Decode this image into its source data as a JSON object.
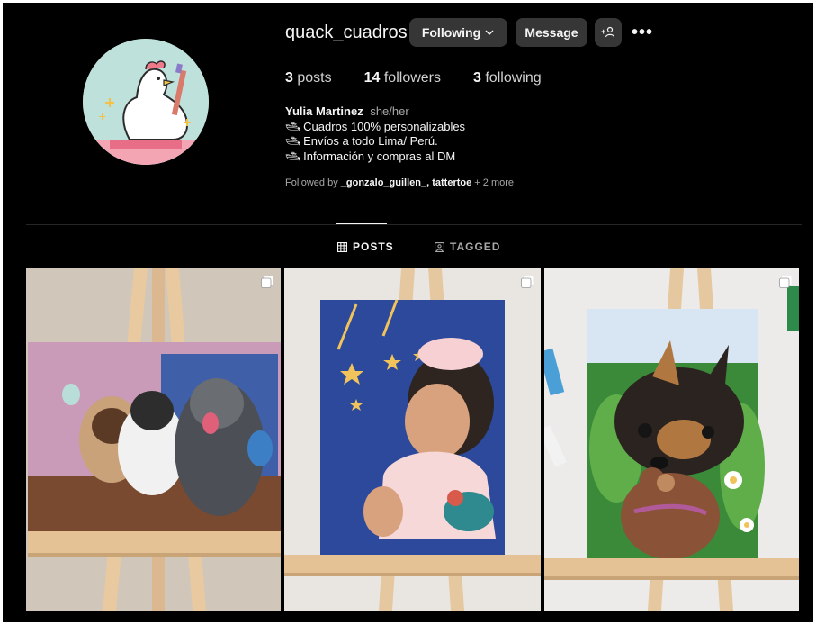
{
  "profile": {
    "username": "quack_cuadros",
    "following_button": "Following",
    "message_button": "Message",
    "add_user_glyph": "+",
    "more_glyph": "•••"
  },
  "stats": [
    {
      "value": "3",
      "label": "posts"
    },
    {
      "value": "14",
      "label": "followers"
    },
    {
      "value": "3",
      "label": "following"
    }
  ],
  "bio": {
    "name": "Yulia Martinez",
    "pronouns": "she/her",
    "lines": [
      "🛥 Cuadros 100% personalizables",
      "🛥 Envíos a todo Lima/ Perú.",
      "🛥 Información y compras al DM"
    ]
  },
  "followed_by": {
    "prefix": "Followed by",
    "users": "_gonzalo_guillen_, tattertoe",
    "suffix": "+ 2 more"
  },
  "tabs": [
    {
      "label": "POSTS",
      "icon": "grid-icon",
      "active": true
    },
    {
      "label": "TAGGED",
      "icon": "tagged-icon",
      "active": false
    }
  ],
  "posts": [
    {
      "subject": "pets-painting",
      "icon": "multiple-images-icon"
    },
    {
      "subject": "baby-painting",
      "icon": "multiple-images-icon"
    },
    {
      "subject": "yorkie-painting",
      "icon": "multiple-images-icon"
    }
  ],
  "colors": {
    "background": "#000000",
    "button": "#363636",
    "text": "#f5f5f5",
    "muted": "#a8a8a8",
    "divider": "#262626"
  }
}
